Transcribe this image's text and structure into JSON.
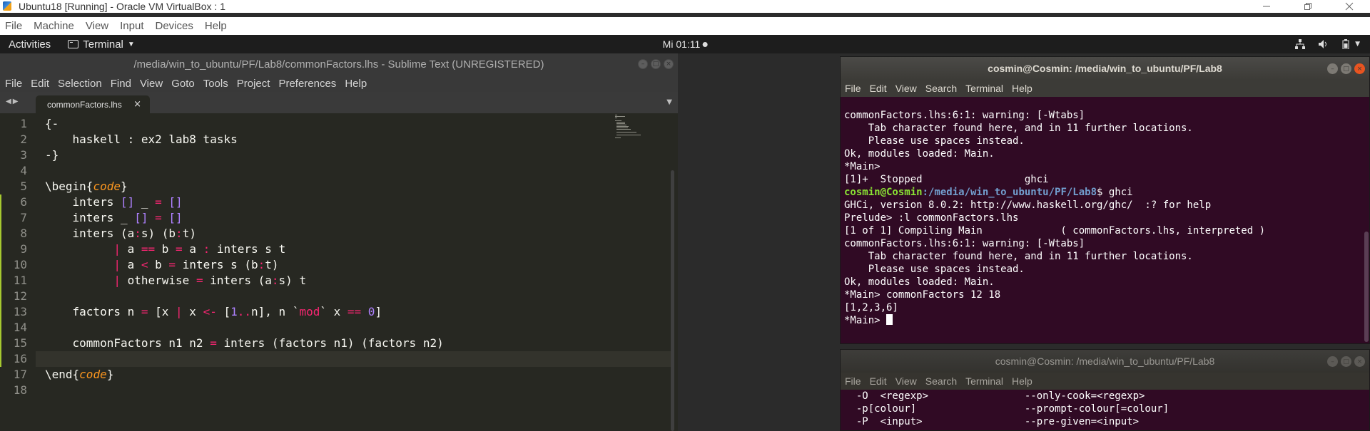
{
  "vbox": {
    "title": "Ubuntu18 [Running] - Oracle VM VirtualBox : 1",
    "menu": [
      "File",
      "Machine",
      "View",
      "Input",
      "Devices",
      "Help"
    ]
  },
  "gnome": {
    "activities": "Activities",
    "app_menu": "Terminal",
    "clock": "Mi 01:11"
  },
  "sublime": {
    "title": "/media/win_to_ubuntu/PF/Lab8/commonFactors.lhs - Sublime Text (UNREGISTERED)",
    "menu": [
      "File",
      "Edit",
      "Selection",
      "Find",
      "View",
      "Goto",
      "Tools",
      "Project",
      "Preferences",
      "Help"
    ],
    "tab_label": "commonFactors.lhs",
    "line_numbers": [
      "1",
      "2",
      "3",
      "4",
      "5",
      "6",
      "7",
      "8",
      "9",
      "10",
      "11",
      "12",
      "13",
      "14",
      "15",
      "16",
      "17",
      "18"
    ],
    "code_lines": [
      "{-",
      "    haskell : ex2 lab8 tasks",
      "-}",
      "",
      "\\begin{code}",
      "    inters [] _ = []",
      "    inters _ [] = []",
      "    inters (a:s) (b:t)",
      "          | a == b = a : inters s t",
      "          | a < b = inters s (b:t)",
      "          | otherwise = inters (a:s) t",
      "",
      "    factors n = [x | x <- [1..n], n `mod` x == 0]",
      "",
      "    commonFactors n1 n2 = inters (factors n1) (factors n2)",
      "",
      "\\end{code}",
      ""
    ]
  },
  "terminal1": {
    "title": "cosmin@Cosmin: /media/win_to_ubuntu/PF/Lab8",
    "menu": [
      "File",
      "Edit",
      "View",
      "Search",
      "Terminal",
      "Help"
    ],
    "lines": [
      "commonFactors.lhs:6:1: warning: [-Wtabs]",
      "    Tab character found here, and in 11 further locations.",
      "    Please use spaces instead.",
      "Ok, modules loaded: Main.",
      "*Main>",
      "[1]+  Stopped                 ghci"
    ],
    "prompt_user": "cosmin@Cosmin",
    "prompt_path": ":/media/win_to_ubuntu/PF/Lab8",
    "prompt_cmd": "$ ghci",
    "lines2": [
      "GHCi, version 8.0.2: http://www.haskell.org/ghc/  :? for help",
      "Prelude> :l commonFactors.lhs",
      "[1 of 1] Compiling Main             ( commonFactors.lhs, interpreted )",
      "",
      "commonFactors.lhs:6:1: warning: [-Wtabs]",
      "    Tab character found here, and in 11 further locations.",
      "    Please use spaces instead.",
      "Ok, modules loaded: Main.",
      "*Main> commonFactors 12 18",
      "[1,2,3,6]"
    ],
    "last_prompt": "*Main> "
  },
  "terminal2": {
    "title": "cosmin@Cosmin: /media/win_to_ubuntu/PF/Lab8",
    "menu": [
      "File",
      "Edit",
      "View",
      "Search",
      "Terminal",
      "Help"
    ],
    "lines": [
      "  -O  <regexp>                --only-cook=<regexp>",
      "  -p[colour]                  --prompt-colour[=colour]",
      "  -P  <input>                 --pre-given=<input>"
    ]
  }
}
